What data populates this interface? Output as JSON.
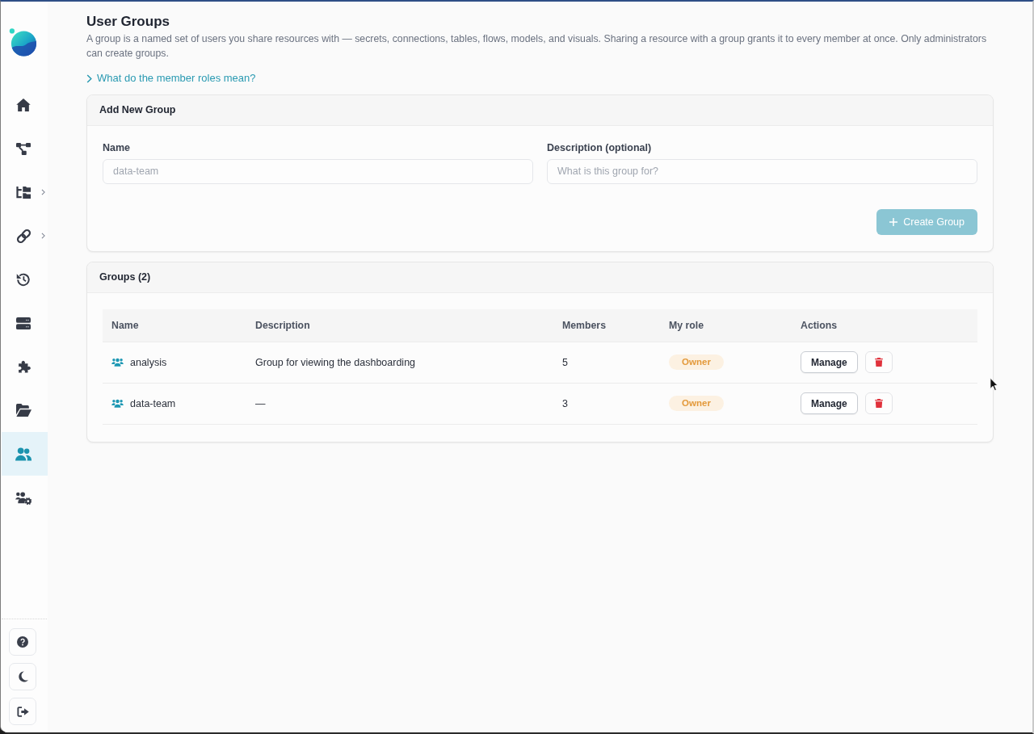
{
  "sidebar": {
    "nav_items": [
      {
        "selected": false,
        "expandable": false
      },
      {
        "selected": false,
        "expandable": false
      },
      {
        "selected": false,
        "expandable": true
      },
      {
        "selected": false,
        "expandable": true
      },
      {
        "selected": false,
        "expandable": false
      },
      {
        "selected": false,
        "expandable": false
      },
      {
        "selected": false,
        "expandable": false
      },
      {
        "selected": false,
        "expandable": false
      },
      {
        "selected": true,
        "expandable": false
      },
      {
        "selected": false,
        "expandable": false
      }
    ]
  },
  "page": {
    "title": "User Groups",
    "description": "A group is a named set of users you share resources with — secrets, connections, tables, flows, models, and visuals. Sharing a resource with a group grants it to every member at once. Only administrators can create groups.",
    "help_link": "What do the member roles mean?",
    "help_expanded": false
  },
  "add_group": {
    "title": "Add New Group",
    "fields": [
      {
        "label": "Name",
        "placeholder": "data-team"
      },
      {
        "label": "Description (optional)",
        "placeholder": "What is this group for?"
      }
    ],
    "create_button": {
      "label": "Create Group",
      "disabled": true
    }
  },
  "groups": {
    "title": "Groups (2)",
    "columns": [
      "Name",
      "Description",
      "Members",
      "My role",
      "Actions"
    ],
    "rows": [
      {
        "name": "analysis",
        "description": "Group for viewing the dashboarding",
        "members": "5",
        "role": "Owner",
        "manage_label": "Manage"
      },
      {
        "name": "data-team",
        "description": "—",
        "members": "3",
        "role": "Owner",
        "manage_label": "Manage"
      }
    ]
  }
}
